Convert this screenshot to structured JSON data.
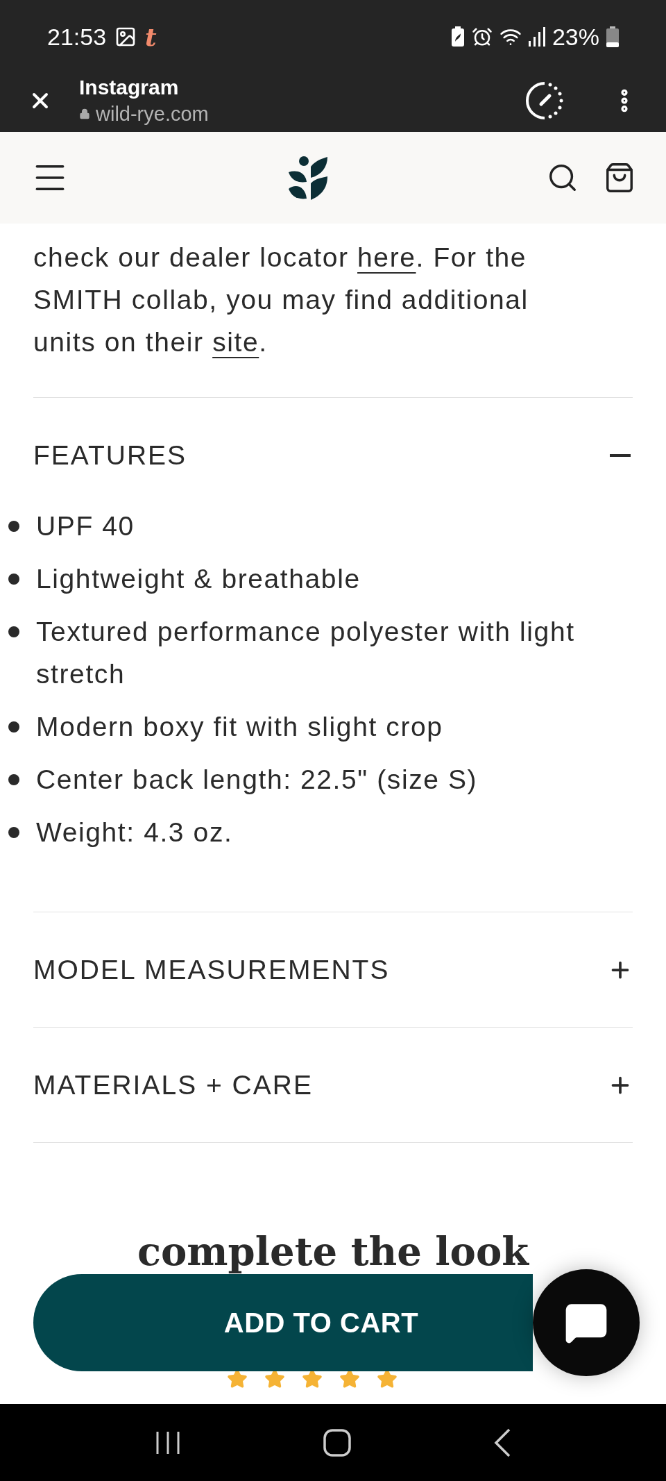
{
  "status_bar": {
    "time": "21:53",
    "notification_glyph": "t",
    "battery": "23%"
  },
  "browser_bar": {
    "title": "Instagram",
    "url": "wild-rye.com"
  },
  "intro": [
    {
      "kind": "text",
      "text": "check our dealer locator "
    },
    {
      "kind": "link",
      "text": "here"
    },
    {
      "kind": "text",
      "text": ". For the SMITH collab, you may find additional units on their "
    },
    {
      "kind": "link",
      "text": "site"
    },
    {
      "kind": "text",
      "text": "."
    }
  ],
  "sections": [
    {
      "title": "FEATURES",
      "expanded": true,
      "items": [
        "UPF 40",
        "Lightweight & breathable",
        "Textured performance polyester with light stretch",
        "Modern boxy fit with slight crop",
        "Center back length: 22.5\" (size S)",
        "Weight: 4.3 oz."
      ]
    },
    {
      "title": "MODEL MEASUREMENTS",
      "expanded": false
    },
    {
      "title": "MATERIALS + CARE",
      "expanded": false
    }
  ],
  "complete_the_look": {
    "heading": "complete the look",
    "stars": 5
  },
  "add_to_cart": {
    "label": "ADD TO CART"
  }
}
